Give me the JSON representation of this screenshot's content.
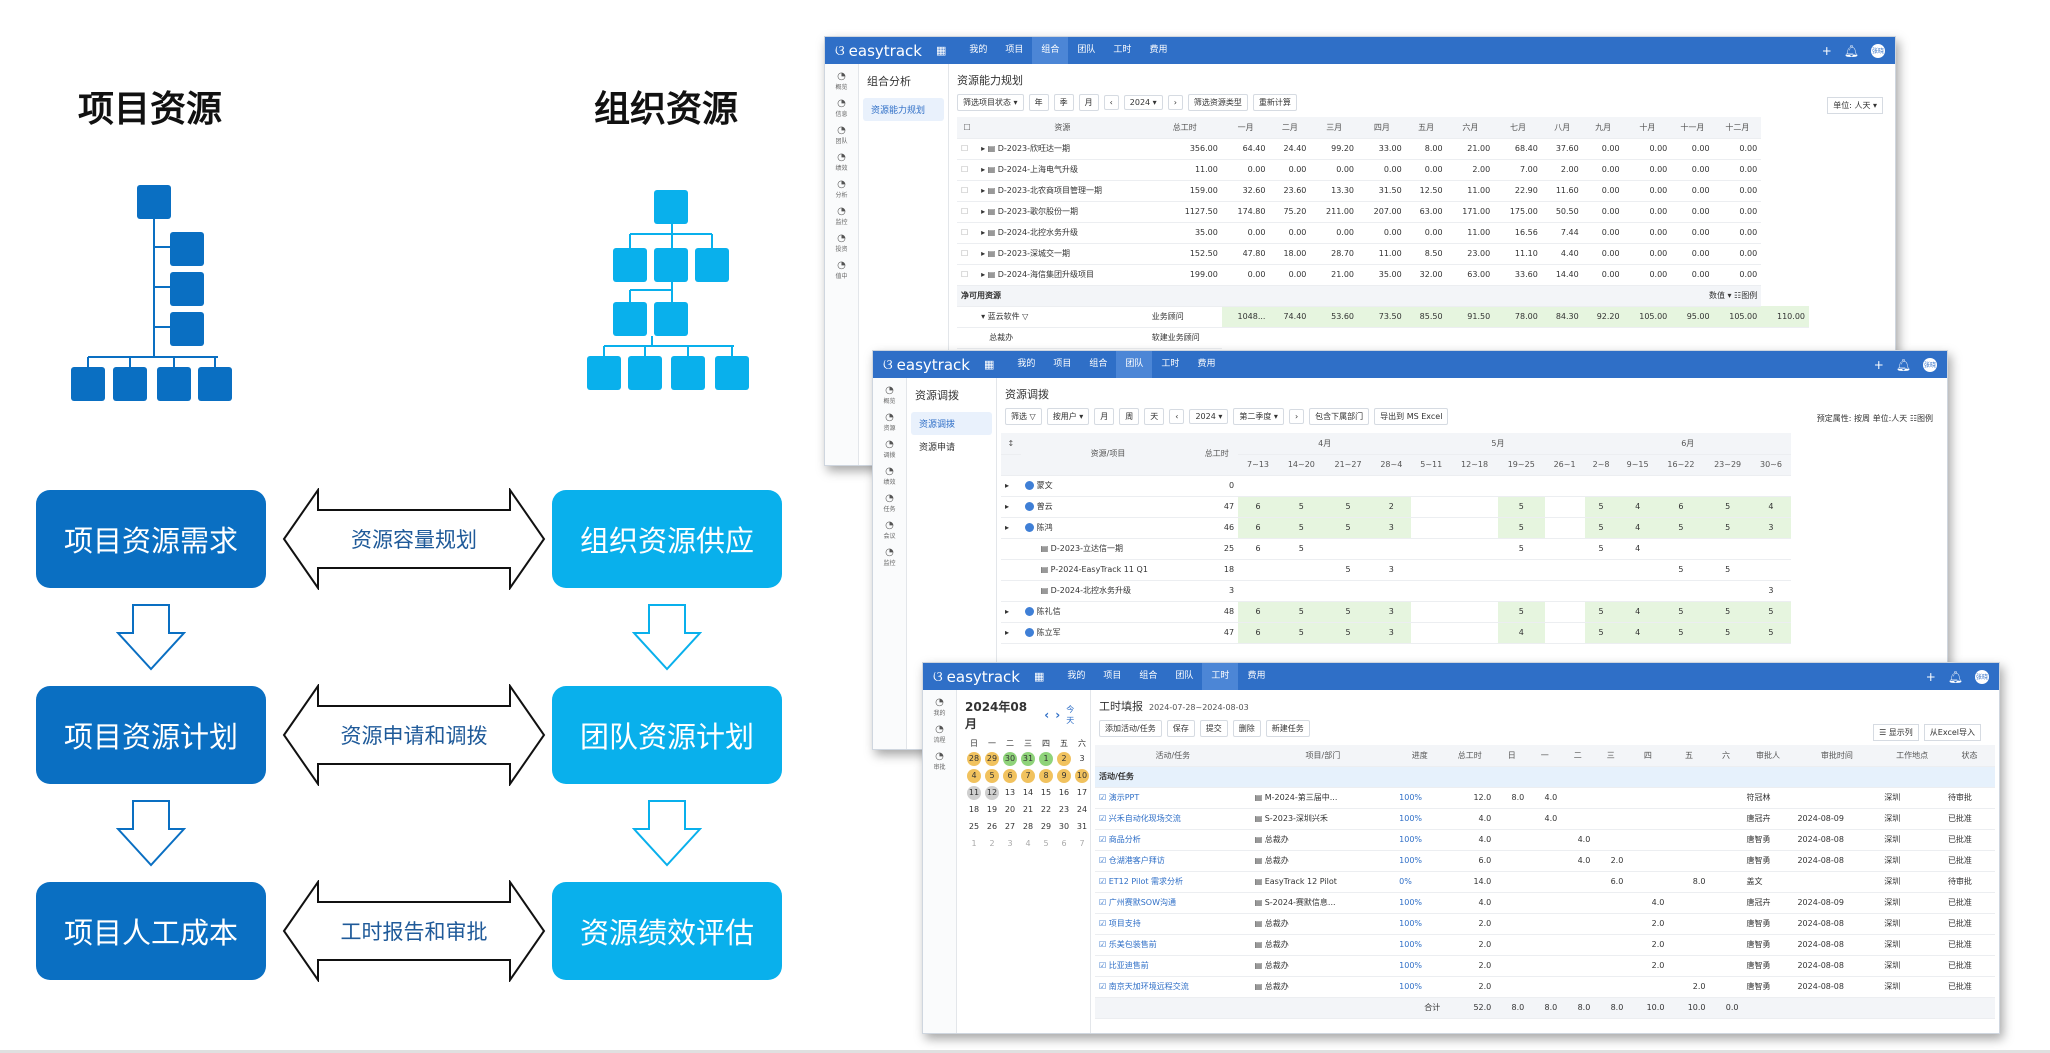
{
  "left_col_title": "项目资源",
  "right_col_title": "组织资源",
  "rows": [
    {
      "left": "项目资源需求",
      "middle": "资源容量规划",
      "right": "组织资源供应"
    },
    {
      "left": "项目资源计划",
      "middle": "资源申请和调拨",
      "right": "团队资源计划"
    },
    {
      "left": "项目人工成本",
      "middle": "工时报告和审批",
      "right": "资源绩效评估"
    }
  ],
  "colors": {
    "dark_box": "#0a6fc2",
    "light_box": "#09b0ec",
    "app_bar": "#2f6fc7"
  },
  "app": {
    "brand": "easytrack",
    "avatar": "张晓"
  },
  "win1": {
    "nav": [
      "我的",
      "项目",
      "组合",
      "团队",
      "工时",
      "费用"
    ],
    "active": "组合",
    "side": [
      "概览",
      "信息",
      "团队",
      "绩效",
      "分析",
      "监控",
      "投资",
      "值中"
    ],
    "sub_title": "组合分析",
    "sub_items": [
      "资源能力规划"
    ],
    "page_title": "资源能力规划",
    "tools": [
      "筛选项目状态 ▾",
      "年",
      "季",
      "月",
      "‹",
      "2024 ▾",
      "›",
      "筛选资源类型",
      "重新计算"
    ],
    "unit": "单位: 人天 ▾",
    "headers": [
      "资源",
      "总工时",
      "一月",
      "二月",
      "三月",
      "四月",
      "五月",
      "六月",
      "七月",
      "八月",
      "九月",
      "十月",
      "十一月",
      "十二月"
    ],
    "rows": [
      [
        "D-2023-欣旺达一期",
        "356.00",
        "64.40",
        "24.40",
        "99.20",
        "33.00",
        "8.00",
        "21.00",
        "68.40",
        "37.60",
        "0.00",
        "0.00",
        "0.00",
        "0.00"
      ],
      [
        "D-2024-上海电气升级",
        "11.00",
        "0.00",
        "0.00",
        "0.00",
        "0.00",
        "0.00",
        "2.00",
        "7.00",
        "2.00",
        "0.00",
        "0.00",
        "0.00",
        "0.00"
      ],
      [
        "D-2023-北农商项目管理一期",
        "159.00",
        "32.60",
        "23.60",
        "13.30",
        "31.50",
        "12.50",
        "11.00",
        "22.90",
        "11.60",
        "0.00",
        "0.00",
        "0.00",
        "0.00"
      ],
      [
        "D-2023-歌尔股份一期",
        "1127.50",
        "174.80",
        "75.20",
        "211.00",
        "207.00",
        "63.00",
        "171.00",
        "175.00",
        "50.50",
        "0.00",
        "0.00",
        "0.00",
        "0.00"
      ],
      [
        "D-2024-北控水务升级",
        "35.00",
        "0.00",
        "0.00",
        "0.00",
        "0.00",
        "0.00",
        "11.00",
        "16.56",
        "7.44",
        "0.00",
        "0.00",
        "0.00",
        "0.00"
      ],
      [
        "D-2023-深城交一期",
        "152.50",
        "47.80",
        "18.00",
        "28.70",
        "11.00",
        "8.50",
        "23.00",
        "11.10",
        "4.40",
        "0.00",
        "0.00",
        "0.00",
        "0.00"
      ],
      [
        "D-2024-海信集团升级项目",
        "199.00",
        "0.00",
        "0.00",
        "21.00",
        "35.00",
        "32.00",
        "63.00",
        "33.60",
        "14.40",
        "0.00",
        "0.00",
        "0.00",
        "0.00"
      ]
    ],
    "section": "净可用资源",
    "section_right": "数值 ▾   ☷图例",
    "res_name": "蓝云软件",
    "res_sub": "总裁办",
    "res_label": "业务顾问",
    "res_label2": "软建业务顾问",
    "res_values": [
      "1048...",
      "74.40",
      "53.60",
      "73.50",
      "85.50",
      "91.50",
      "78.00",
      "84.30",
      "92.20",
      "105.00",
      "95.00",
      "105.00",
      "110.00"
    ]
  },
  "win2": {
    "nav": [
      "我的",
      "项目",
      "组合",
      "团队",
      "工时",
      "费用"
    ],
    "active": "团队",
    "side": [
      "概览",
      "资源",
      "调拨",
      "绩效",
      "任务",
      "会议",
      "监控"
    ],
    "sub_title": "资源调拨",
    "sub_items": [
      "资源调拨",
      "资源申请"
    ],
    "page_title": "资源调拨",
    "tools": [
      "筛选 ▽",
      "按用户 ▾",
      "月",
      "周",
      "天",
      "‹",
      "2024 ▾",
      "第二季度 ▾",
      "›",
      "包含下属部门",
      "导出到 MS Excel"
    ],
    "right_info": "预定属性: 按周   单位:人天   ☷图例",
    "months": [
      "4月",
      "5月",
      "6月"
    ],
    "weeks": [
      "7~13",
      "14~20",
      "21~27",
      "28~4",
      "5~11",
      "12~18",
      "19~25",
      "26~1",
      "2~8",
      "9~15",
      "16~22",
      "23~29",
      "30~6"
    ],
    "col_res": "资源/项目",
    "col_total": "总工时",
    "rows": [
      {
        "name": "蒙文",
        "total": "0",
        "v": [
          "",
          "",
          "",
          "",
          "",
          "",
          "",
          "",
          "",
          "",
          "",
          "",
          ""
        ],
        "type": "person"
      },
      {
        "name": "曾云",
        "total": "47",
        "v": [
          "6",
          "5",
          "5",
          "2",
          "",
          "",
          "5",
          "",
          "5",
          "4",
          "6",
          "5",
          "4"
        ],
        "type": "person"
      },
      {
        "name": "陈鸿",
        "total": "46",
        "v": [
          "6",
          "5",
          "5",
          "3",
          "",
          "",
          "5",
          "",
          "5",
          "4",
          "5",
          "5",
          "3"
        ],
        "type": "person"
      },
      {
        "name": "D-2023-立达信一期",
        "total": "25",
        "v": [
          "6",
          "5",
          "",
          "",
          "",
          "",
          "5",
          "",
          "5",
          "4",
          "",
          "",
          ""
        ],
        "type": "proj"
      },
      {
        "name": "P-2024-EasyTrack 11 Q1",
        "total": "18",
        "v": [
          "",
          "",
          "5",
          "3",
          "",
          "",
          "",
          "",
          "",
          "",
          "5",
          "5",
          ""
        ],
        "type": "proj"
      },
      {
        "name": "D-2024-北控水务升级",
        "total": "3",
        "v": [
          "",
          "",
          "",
          "",
          "",
          "",
          "",
          "",
          "",
          "",
          "",
          "",
          "3"
        ],
        "type": "proj"
      },
      {
        "name": "陈礼信",
        "total": "48",
        "v": [
          "6",
          "5",
          "5",
          "3",
          "",
          "",
          "5",
          "",
          "5",
          "4",
          "5",
          "5",
          "5"
        ],
        "type": "person"
      },
      {
        "name": "陈立军",
        "total": "47",
        "v": [
          "6",
          "5",
          "5",
          "3",
          "",
          "",
          "4",
          "",
          "5",
          "4",
          "5",
          "5",
          "5"
        ],
        "type": "person"
      }
    ]
  },
  "win3": {
    "nav": [
      "我的",
      "项目",
      "组合",
      "团队",
      "工时",
      "费用"
    ],
    "active": "工时",
    "side": [
      "我的",
      "流程",
      "审批"
    ],
    "month_title": "2024年08月",
    "today": "今天",
    "weekdays": [
      "日",
      "一",
      "二",
      "三",
      "四",
      "五",
      "六"
    ],
    "days": [
      [
        "28",
        "cy"
      ],
      [
        "29",
        "cy"
      ],
      [
        "30",
        "cg"
      ],
      [
        "31",
        "cg"
      ],
      [
        "1",
        "cg"
      ],
      [
        "2",
        "cy"
      ],
      [
        "3",
        ""
      ],
      [
        "4",
        "cy"
      ],
      [
        "5",
        "cy"
      ],
      [
        "6",
        "cy"
      ],
      [
        "7",
        "cy"
      ],
      [
        "8",
        "cy"
      ],
      [
        "9",
        "cy"
      ],
      [
        "10",
        "cy"
      ],
      [
        "11",
        "cx"
      ],
      [
        "12",
        "cx"
      ],
      [
        "13",
        ""
      ],
      [
        "14",
        ""
      ],
      [
        "15",
        ""
      ],
      [
        "16",
        ""
      ],
      [
        "17",
        ""
      ],
      [
        "18",
        ""
      ],
      [
        "19",
        ""
      ],
      [
        "20",
        ""
      ],
      [
        "21",
        ""
      ],
      [
        "22",
        ""
      ],
      [
        "23",
        ""
      ],
      [
        "24",
        ""
      ],
      [
        "25",
        ""
      ],
      [
        "26",
        ""
      ],
      [
        "27",
        ""
      ],
      [
        "28",
        ""
      ],
      [
        "29",
        ""
      ],
      [
        "30",
        ""
      ],
      [
        "31",
        ""
      ],
      [
        "1",
        ""
      ],
      [
        "2",
        ""
      ],
      [
        "3",
        ""
      ],
      [
        "4",
        ""
      ],
      [
        "5",
        ""
      ],
      [
        "6",
        ""
      ],
      [
        "7",
        ""
      ]
    ],
    "page_title": "工时填报",
    "range": "2024-07-28~2024-08-03",
    "tools": [
      "添加活动/任务",
      "保存",
      "提交",
      "删除",
      "新建任务"
    ],
    "right_tools": [
      "☰ 显示列",
      "从Excel导入"
    ],
    "headers": [
      "活动/任务",
      "项目/部门",
      "进度",
      "总工时",
      "日",
      "一",
      "二",
      "三",
      "四",
      "五",
      "六",
      "审批人",
      "审批时间",
      "工作地点",
      "状态"
    ],
    "group": "活动/任务",
    "rows": [
      [
        "演示PPT",
        "M-2024-第三届中...",
        "100%",
        "12.0",
        "8.0",
        "4.0",
        "",
        "",
        "",
        "",
        "",
        "符冠林",
        "",
        "深圳",
        "待审批"
      ],
      [
        "兴禾自动化现场交流",
        "S-2023-深圳兴禾",
        "100%",
        "4.0",
        "",
        "4.0",
        "",
        "",
        "",
        "",
        "",
        "唐冠卉",
        "2024-08-09",
        "深圳",
        "已批准"
      ],
      [
        "商品分析",
        "总裁办",
        "100%",
        "4.0",
        "",
        "",
        "4.0",
        "",
        "",
        "",
        "",
        "唐智勇",
        "2024-08-08",
        "深圳",
        "已批准"
      ],
      [
        "仓湖港客户拜访",
        "总裁办",
        "100%",
        "6.0",
        "",
        "",
        "4.0",
        "2.0",
        "",
        "",
        "",
        "唐智勇",
        "2024-08-08",
        "深圳",
        "已批准"
      ],
      [
        "ET12 Pilot 需求分析",
        "EasyTrack 12 Pilot",
        "0%",
        "14.0",
        "",
        "",
        "",
        "6.0",
        "",
        "8.0",
        "",
        "盖文",
        "",
        "深圳",
        "待审批"
      ],
      [
        "广州赛默SOW沟通",
        "S-2024-赛默信息...",
        "100%",
        "4.0",
        "",
        "",
        "",
        "",
        "4.0",
        "",
        "",
        "唐冠卉",
        "2024-08-09",
        "深圳",
        "已批准"
      ],
      [
        "项目支持",
        "总裁办",
        "100%",
        "2.0",
        "",
        "",
        "",
        "",
        "2.0",
        "",
        "",
        "唐智勇",
        "2024-08-08",
        "深圳",
        "已批准"
      ],
      [
        "乐美包装售前",
        "总裁办",
        "100%",
        "2.0",
        "",
        "",
        "",
        "",
        "2.0",
        "",
        "",
        "唐智勇",
        "2024-08-08",
        "深圳",
        "已批准"
      ],
      [
        "比亚迪售前",
        "总裁办",
        "100%",
        "2.0",
        "",
        "",
        "",
        "",
        "2.0",
        "",
        "",
        "唐智勇",
        "2024-08-08",
        "深圳",
        "已批准"
      ],
      [
        "南京天加环境远程交流",
        "总裁办",
        "100%",
        "2.0",
        "",
        "",
        "",
        "",
        "",
        "2.0",
        "",
        "唐智勇",
        "2024-08-08",
        "深圳",
        "已批准"
      ]
    ],
    "total_row": [
      "合计",
      "52.0",
      "8.0",
      "8.0",
      "8.0",
      "8.0",
      "10.0",
      "10.0",
      "0.0"
    ]
  }
}
